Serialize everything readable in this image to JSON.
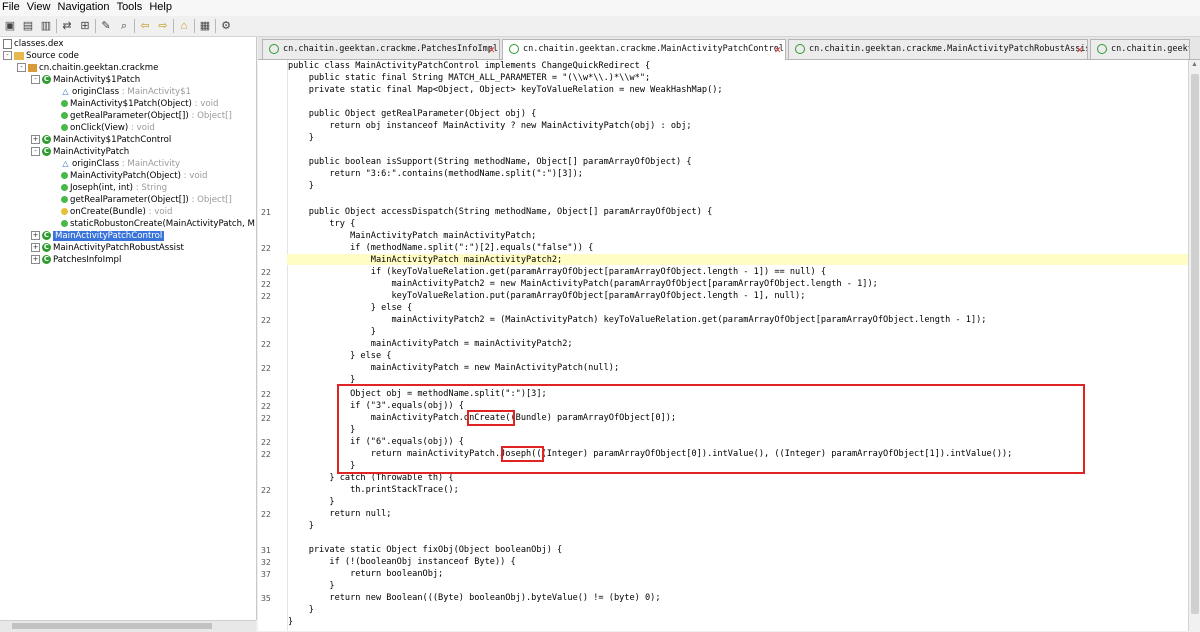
{
  "menu": [
    "File",
    "View",
    "Navigation",
    "Tools",
    "Help"
  ],
  "toolbar_icons": [
    "open-file-icon",
    "save-icon",
    "save-all-icon",
    "sync-icon",
    "flatten-icon",
    "wand-icon",
    "search-icon",
    "back-icon",
    "forward-icon",
    "lock-icon",
    "log-icon",
    "settings-icon"
  ],
  "tree": {
    "root": "classes.dex",
    "source": "Source code",
    "package": "cn.chaitin.geektan.crackme",
    "n1_cls": "MainActivity$1Patch",
    "n1_f1": "originClass",
    "n1_f1m": " : MainActivity$1",
    "n1_m1": "MainActivity$1Patch(Object)",
    "n1_m1m": " : void",
    "n1_m2": "getRealParameter(Object[])",
    "n1_m2m": " : Object[]",
    "n1_m3": "onClick(View)",
    "n1_m3m": " : void",
    "n2_cls": "MainActivity$1PatchControl",
    "n3_cls": "MainActivityPatch",
    "n3_f1": "originClass",
    "n3_f1m": " : MainActivity",
    "n3_m1": "MainActivityPatch(Object)",
    "n3_m1m": " : void",
    "n3_m2": "Joseph(int, int)",
    "n3_m2m": " : String",
    "n3_m3": "getRealParameter(Object[])",
    "n3_m3m": " : Object[]",
    "n3_m4": "onCreate(Bundle)",
    "n3_m4m": " : void",
    "n3_m5": "staticRobustonCreate(MainActivityPatch, M",
    "n4_cls": "MainActivityPatchControl",
    "n5_cls": "MainActivityPatchRobustAssist",
    "n6_cls": "PatchesInfoImpl"
  },
  "tabs": [
    "cn.chaitin.geektan.crackme.PatchesInfoImpl",
    "cn.chaitin.geektan.crackme.MainActivityPatchControl",
    "cn.chaitin.geektan.crackme.MainActivityPatchRobustAssist",
    "cn.chaitin.geekt"
  ],
  "code": {
    "l01": "public class MainActivityPatchControl implements ChangeQuickRedirect {",
    "l02": "    public static final String MATCH_ALL_PARAMETER = \"(\\\\w*\\\\.)*\\\\w*\";",
    "l03": "    private static final Map<Object, Object> keyToValueRelation = new WeakHashMap();",
    "l04": "    public Object getRealParameter(Object obj) {",
    "l05": "        return obj instanceof MainActivity ? new MainActivityPatch(obj) : obj;",
    "l06": "    }",
    "l07": "    public boolean isSupport(String methodName, Object[] paramArrayOfObject) {",
    "l08": "        return \"3:6:\".contains(methodName.split(\":\")[3]);",
    "l09": "    }",
    "l10": "    public Object accessDispatch(String methodName, Object[] paramArrayOfObject) {",
    "l11": "        try {",
    "l12": "            MainActivityPatch mainActivityPatch;",
    "l13": "            if (methodName.split(\":\")[2].equals(\"false\")) {",
    "l14": "                MainActivityPatch mainActivityPatch2;",
    "l15": "                if (keyToValueRelation.get(paramArrayOfObject[paramArrayOfObject.length - 1]) == null) {",
    "l16": "                    mainActivityPatch2 = new MainActivityPatch(paramArrayOfObject[paramArrayOfObject.length - 1]);",
    "l17": "                    keyToValueRelation.put(paramArrayOfObject[paramArrayOfObject.length - 1], null);",
    "l18": "                } else {",
    "l19": "                    mainActivityPatch2 = (MainActivityPatch) keyToValueRelation.get(paramArrayOfObject[paramArrayOfObject.length - 1]);",
    "l20": "                }",
    "l21": "                mainActivityPatch = mainActivityPatch2;",
    "l22": "            } else {",
    "l23": "                mainActivityPatch = new MainActivityPatch(null);",
    "l24": "            }",
    "l25": "            Object obj = methodName.split(\":\")[3];",
    "l26": "            if (\"3\".equals(obj)) {",
    "l27": "                mainActivityPatch.onCreate((Bundle) paramArrayOfObject[0]);",
    "l28": "            }",
    "l29": "            if (\"6\".equals(obj)) {",
    "l30": "                return mainActivityPatch.Joseph(((Integer) paramArrayOfObject[0]).intValue(), ((Integer) paramArrayOfObject[1]).intValue());",
    "l31": "            }",
    "l32": "        } catch (Throwable th) {",
    "l33": "            th.printStackTrace();",
    "l34": "        }",
    "l35": "        return null;",
    "l36": "    }",
    "l37": "    private static Object fixObj(Object booleanObj) {",
    "l38": "        if (!(booleanObj instanceof Byte)) {",
    "l39": "            return booleanObj;",
    "l40": "        }",
    "l41": "        return new Boolean(((Byte) booleanObj).byteValue() != (byte) 0);",
    "l42": "    }",
    "l43": "}"
  },
  "line_numbers": {
    "n21": "21",
    "n22": "22",
    "n31": "31",
    "n32": "32",
    "n37": "37",
    "n35": "35"
  }
}
